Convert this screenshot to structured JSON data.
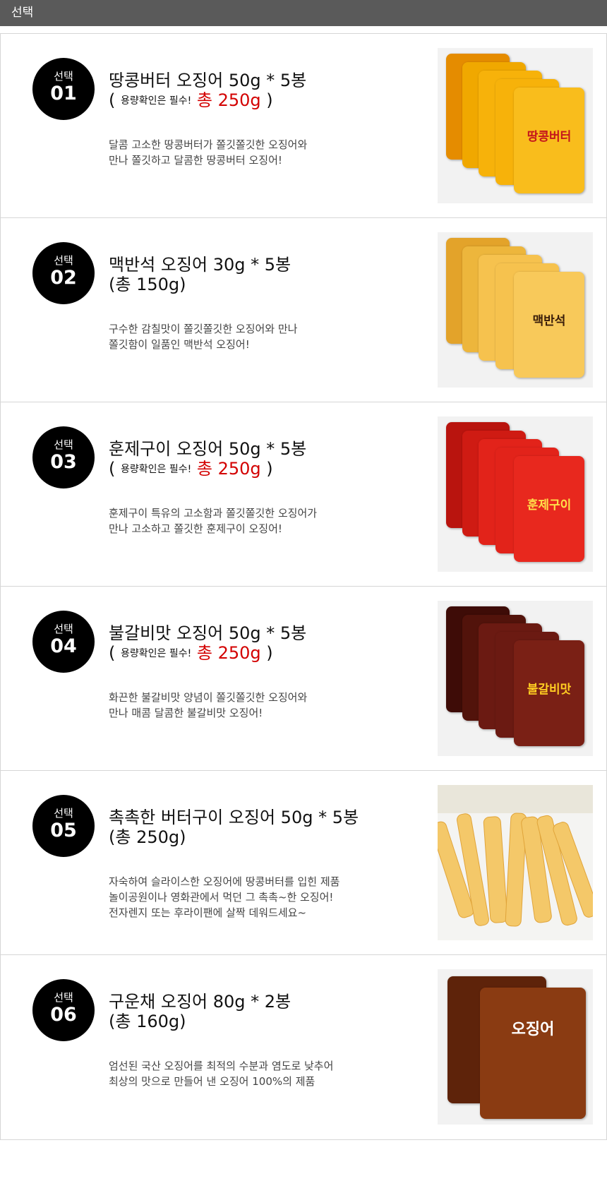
{
  "header": {
    "title": "선택"
  },
  "items": [
    {
      "sel_label": "선택",
      "num": "01",
      "title": "땅콩버터 오징어 50g * 5봉",
      "sub_open": "( ",
      "sub_small": "용량확인은 필수!",
      "sub_red": " 총 250g",
      "sub_close": " )",
      "desc1": "달콤 고소한 땅콩버터가 쫄깃쫄깃한 오징어와",
      "desc2": "만나 쫄깃하고 달콤한 땅콩버터 오징어!",
      "desc3": "",
      "pack_label": "땅콩버터",
      "colors": {
        "pack": "#f7b20a",
        "pack_dark": "#e58c00",
        "label": "#c4151c",
        "bg": "#f2f2f2"
      }
    },
    {
      "sel_label": "선택",
      "num": "02",
      "title": "맥반석 오징어 30g * 5봉",
      "sub_plain": "(총 150g)",
      "desc1": "구수한 감칠맛이 쫄깃쫄깃한 오징어와 만나",
      "desc2": "쫄깃함이 일품인 맥반석 오징어!",
      "desc3": "",
      "pack_label": "맥반석",
      "colors": {
        "pack": "#f6c24e",
        "pack_dark": "#e3a32a",
        "label": "#3a1d0a",
        "bg": "#f2f2f2"
      }
    },
    {
      "sel_label": "선택",
      "num": "03",
      "title": "훈제구이 오징어 50g * 5봉",
      "sub_open": "( ",
      "sub_small": "용량확인은 필수!",
      "sub_red": " 총 250g",
      "sub_close": " )",
      "desc1": "훈제구이 특유의 고소함과 쫄깃쫄깃한 오징어가",
      "desc2": "만나 고소하고 쫄깃한 훈제구이 오징어!",
      "desc3": "",
      "pack_label": "훈제구이",
      "colors": {
        "pack": "#e2231a",
        "pack_dark": "#b9140e",
        "label": "#ffe14a",
        "bg": "#f2f2f2"
      }
    },
    {
      "sel_label": "선택",
      "num": "04",
      "title": "불갈비맛 오징어 50g * 5봉",
      "sub_open": "( ",
      "sub_small": "용량확인은 필수!",
      "sub_red": " 총 250g",
      "sub_close": " )",
      "desc1": "화끈한 불갈비맛 양념이 쫄깃쫄깃한 오징어와",
      "desc2": "만나 매콤 달콤한 불갈비맛 오징어!",
      "desc3": "",
      "pack_label": "불갈비맛",
      "colors": {
        "pack": "#6b1a12",
        "pack_dark": "#3e0c07",
        "label": "#ffcc22",
        "bg": "#f2f2f2"
      }
    },
    {
      "sel_label": "선택",
      "num": "05",
      "title": "촉촉한 버터구이 오징어 50g * 5봉",
      "sub_plain": "(총 250g)",
      "desc1": "자숙하여 슬라이스한 오징어에 땅콩버터를 입힌 제품",
      "desc2": "놀이공원이나 영화관에서 먹던 그 촉촉~한 오징어!",
      "desc3": "전자렌지 또는 후라이팬에 살짝 데워드세요~",
      "pack_label": "",
      "colors": {
        "pack": "#f4c869",
        "pack_dark": "#e0a43a",
        "label": "#7a5a2a",
        "bg": "#f4f4f2"
      }
    },
    {
      "sel_label": "선택",
      "num": "06",
      "title": "구운채 오징어 80g * 2봉",
      "sub_plain": "(총 160g)",
      "desc1": "엄선된 국산 오징어를 최적의 수분과 염도로 낮추어",
      "desc2": "최상의 맛으로 만들어 낸 오징어 100%의 제품",
      "desc3": "",
      "pack_label": "오징어",
      "colors": {
        "pack": "#8a3b12",
        "pack_dark": "#5e230a",
        "label": "#ffffff",
        "bg": "#f2f2f2"
      }
    }
  ],
  "icons": [
    "product-photo-icon"
  ]
}
